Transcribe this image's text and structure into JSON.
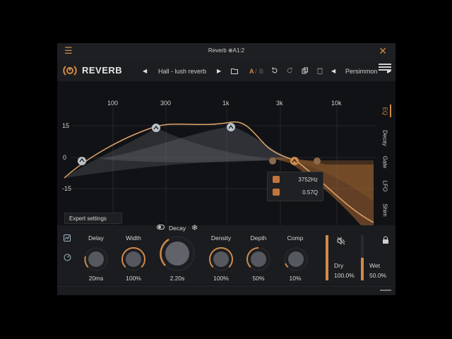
{
  "window": {
    "title": "Reverb ⊕A1:2"
  },
  "header": {
    "plugin_name": "REVERB",
    "preset_name": "Hall - lush reverb",
    "ab_a": "A",
    "ab_sep": "/",
    "ab_b": "B",
    "preset_bank": "Persimmon"
  },
  "eq": {
    "freq_labels": [
      "100",
      "300",
      "1k",
      "3k",
      "10k"
    ],
    "db_labels": [
      "15",
      "0",
      "-15"
    ],
    "side_tabs": [
      "EQ",
      "Decay",
      "Gate",
      "LFO",
      "Shim"
    ],
    "tooltip": {
      "freq": "3752Hz",
      "q": "0.57Q"
    },
    "expert_label": "Expert settings"
  },
  "controls": {
    "decay_label": "Decay",
    "knobs": [
      {
        "label": "Delay",
        "value": "20ms",
        "level": 0.25
      },
      {
        "label": "Width",
        "value": "100%",
        "level": 1.0
      },
      {
        "label": "Decay",
        "value": "2.20s",
        "level": 0.45
      },
      {
        "label": "Density",
        "value": "100%",
        "level": 1.0
      },
      {
        "label": "Depth",
        "value": "50%",
        "level": 0.5
      },
      {
        "label": "Comp",
        "value": "10%",
        "level": 0.1
      }
    ],
    "dry": {
      "label": "Dry",
      "value": "100.0%",
      "level": 1.0
    },
    "wet": {
      "label": "Wet",
      "value": "50.0%",
      "level": 0.5
    }
  },
  "colors": {
    "accent": "#d08a4a",
    "background": "#111215",
    "panel": "#1b1c1f"
  },
  "icons": [
    "menu-icon",
    "close-icon",
    "logo-icon",
    "folder-icon",
    "undo-icon",
    "redo-icon",
    "copy-icon",
    "trash-icon",
    "hamburger-icon",
    "snowflake-icon",
    "mute-icon",
    "lock-icon"
  ]
}
